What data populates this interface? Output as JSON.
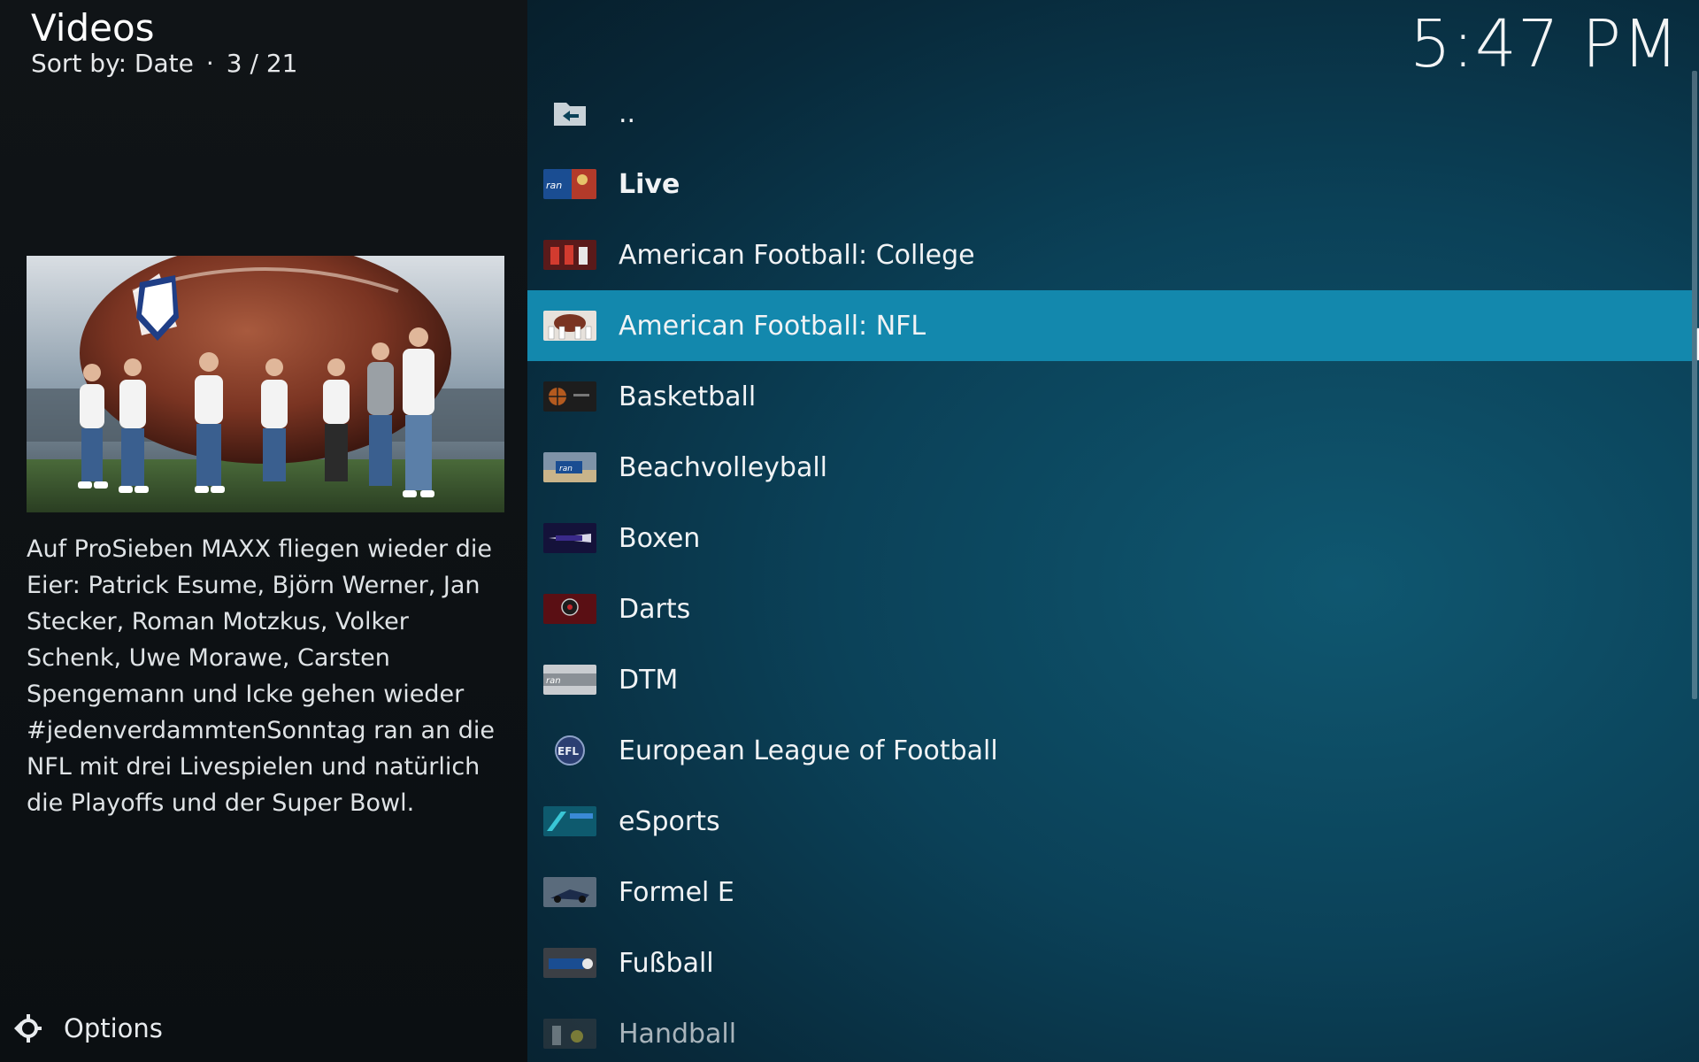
{
  "header": {
    "title": "Videos",
    "sort_label": "Sort by: Date",
    "separator": "·",
    "position": "3 / 21"
  },
  "clock": "5:47 PM",
  "info": {
    "plot": "Auf ProSieben MAXX fliegen wieder die Eier: Patrick Esume, Björn Werner, Jan Stecker, Roman Motzkus, Volker Schenk, Uwe Morawe, Carsten Spengemann und Icke gehen wieder #jedenverdammtenSonntag ran an die NFL mit drei Livespielen und natürlich die Playoffs und der Super Bowl."
  },
  "options_label": "Options",
  "list": {
    "items": [
      {
        "label": "..",
        "icon": "folder-back-icon"
      },
      {
        "label": "Live",
        "icon": "live-thumbnail"
      },
      {
        "label": "American Football: College",
        "icon": "college-football-thumbnail"
      },
      {
        "label": "American Football: NFL",
        "icon": "nfl-thumbnail"
      },
      {
        "label": "Basketball",
        "icon": "basketball-thumbnail"
      },
      {
        "label": "Beachvolleyball",
        "icon": "beachvolleyball-thumbnail"
      },
      {
        "label": "Boxen",
        "icon": "boxen-thumbnail"
      },
      {
        "label": "Darts",
        "icon": "darts-thumbnail"
      },
      {
        "label": "DTM",
        "icon": "dtm-thumbnail"
      },
      {
        "label": "European League of Football",
        "icon": "efl-logo-thumbnail"
      },
      {
        "label": "eSports",
        "icon": "esports-thumbnail"
      },
      {
        "label": "Formel E",
        "icon": "formel-e-thumbnail"
      },
      {
        "label": "Fußball",
        "icon": "fussball-thumbnail"
      },
      {
        "label": "Handball",
        "icon": "handball-thumbnail"
      }
    ],
    "selected_index": 3
  },
  "colors": {
    "selection": "#1388ad",
    "list_background": "#0b4158",
    "left_background": "#101417",
    "text": "#ffffff"
  }
}
